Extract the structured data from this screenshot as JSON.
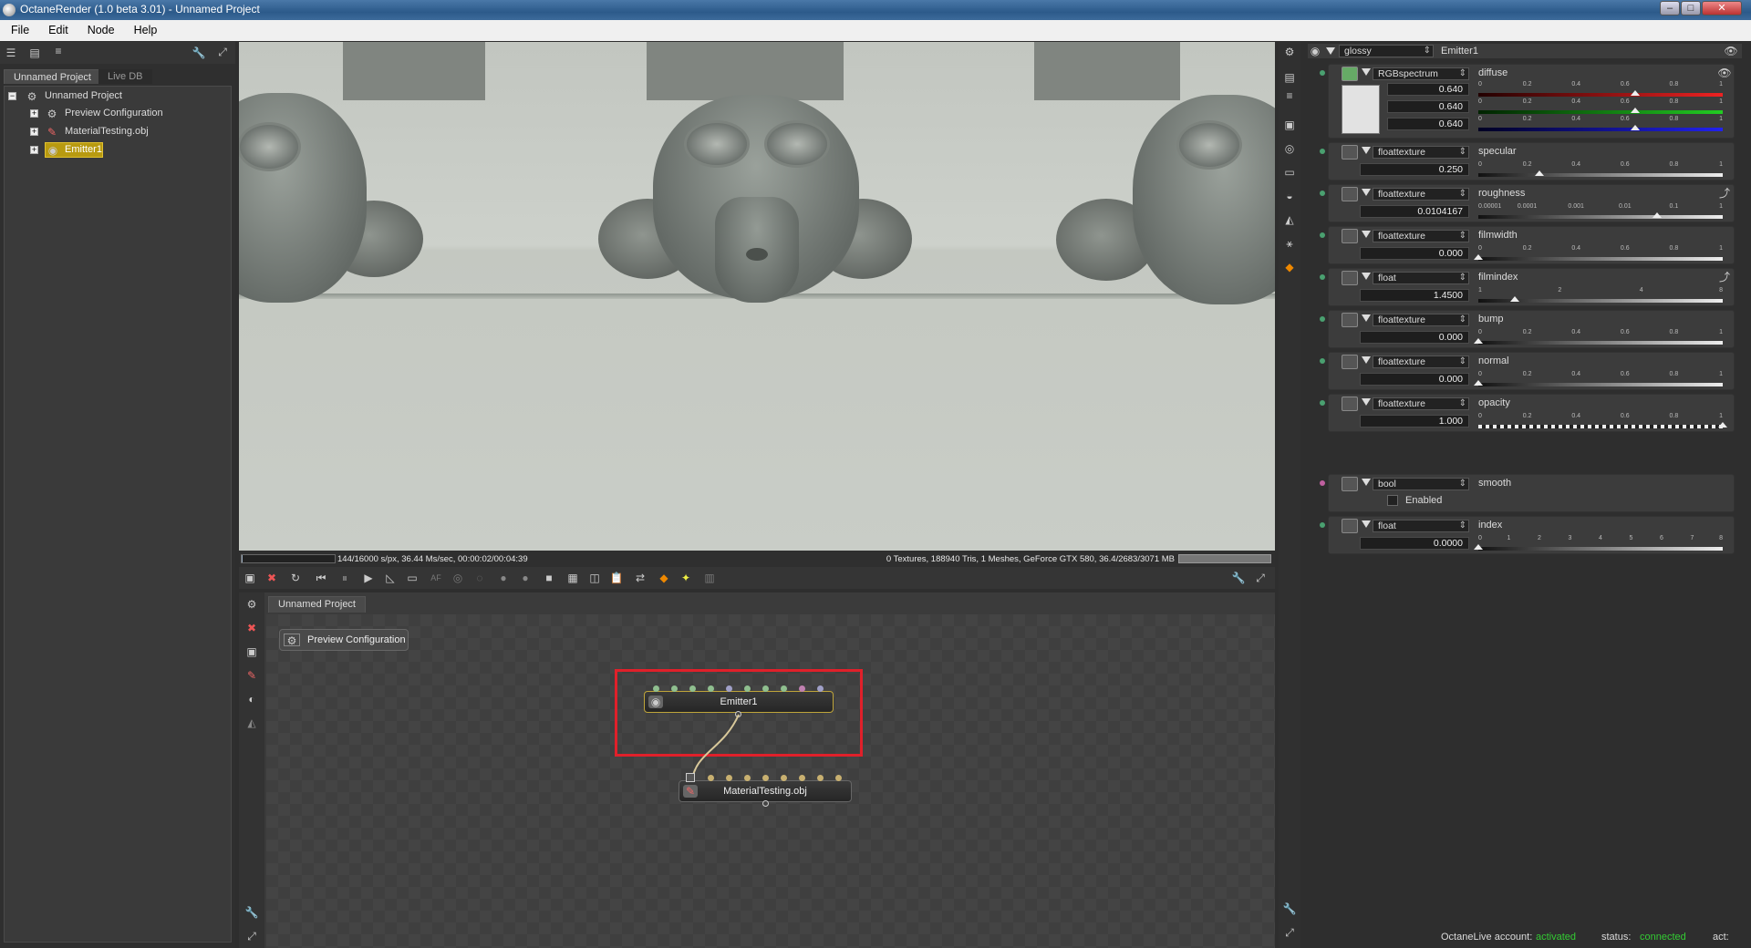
{
  "window": {
    "title": "OctaneRender (1.0 beta 3.01) - Unnamed Project"
  },
  "menu": [
    "File",
    "Edit",
    "Node",
    "Help"
  ],
  "scene_panel": {
    "tabs": [
      "Unnamed Project",
      "Live DB"
    ],
    "root": "Unnamed Project",
    "items": [
      "Preview Configuration",
      "MaterialTesting.obj",
      "Emitter1"
    ]
  },
  "render_status": {
    "left": "144/16000 s/px, 36.44 Ms/sec, 00:00:02/00:04:39",
    "right": "0 Textures, 188940 Tris, 1 Meshes, GeForce GTX 580, 36.4/2683/3071 MB",
    "progress": 0.009
  },
  "graph": {
    "tab": "Unnamed Project",
    "nodes": {
      "preview": "Preview Configuration",
      "emitter": "Emitter1",
      "mesh": "MaterialTesting.obj"
    }
  },
  "inspector": {
    "material_type": "glossy",
    "node_name": "Emitter1",
    "diffuse": {
      "type": "RGBspectrum",
      "name": "diffuse",
      "values": [
        "0.640",
        "0.640",
        "0.640"
      ],
      "ticks": [
        "0",
        "0.2",
        "0.4",
        "0.6",
        "0.8",
        "1"
      ],
      "level": 0.64
    },
    "rows": [
      {
        "type": "floattexture",
        "name": "specular",
        "value": "0.250",
        "ticks": [
          "0",
          "0.2",
          "0.4",
          "0.6",
          "0.8",
          "1"
        ],
        "level": 0.25
      },
      {
        "type": "floattexture",
        "name": "roughness",
        "value": "0.0104167",
        "ticks": [
          "0.00001",
          "0.0001",
          "0.001",
          "0.01",
          "0.1",
          "1"
        ],
        "level": 0.73
      },
      {
        "type": "floattexture",
        "name": "filmwidth",
        "value": "0.000",
        "ticks": [
          "0",
          "0.2",
          "0.4",
          "0.6",
          "0.8",
          "1"
        ],
        "level": 0.0
      },
      {
        "type": "float",
        "name": "filmindex",
        "value": "1.4500",
        "ticks": [
          "1",
          "2",
          "4",
          "8"
        ],
        "level": 0.15
      },
      {
        "type": "floattexture",
        "name": "bump",
        "value": "0.000",
        "ticks": [
          "0",
          "0.2",
          "0.4",
          "0.6",
          "0.8",
          "1"
        ],
        "level": 0.0
      },
      {
        "type": "floattexture",
        "name": "normal",
        "value": "0.000",
        "ticks": [
          "0",
          "0.2",
          "0.4",
          "0.6",
          "0.8",
          "1"
        ],
        "level": 0.0
      },
      {
        "type": "floattexture",
        "name": "opacity",
        "value": "1.000",
        "ticks": [
          "0",
          "0.2",
          "0.4",
          "0.6",
          "0.8",
          "1"
        ],
        "level": 1.0
      }
    ],
    "smooth": {
      "type": "bool",
      "name": "smooth",
      "checkbox_label": "Enabled"
    },
    "index": {
      "type": "float",
      "name": "index",
      "value": "0.0000",
      "ticks": [
        "0",
        "1",
        "2",
        "3",
        "4",
        "5",
        "6",
        "7",
        "8"
      ],
      "level": 0.0
    }
  },
  "footer": {
    "account_label": "OctaneLive account:",
    "account_value": "activated",
    "status_label": "status:",
    "status_value": "connected",
    "act_label": "act:"
  }
}
